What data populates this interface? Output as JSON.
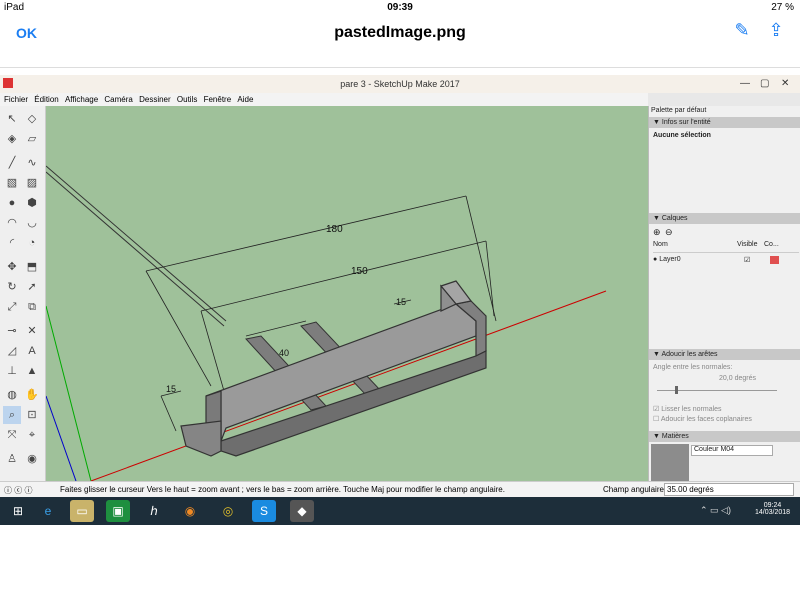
{
  "ios": {
    "carrier": "iPad",
    "time": "09:39",
    "battery": "27 %",
    "ok_label": "OK",
    "title": "pastedImage.png"
  },
  "window": {
    "title": "pare 3 - SketchUp Make 2017"
  },
  "menu": [
    "Fichier",
    "Édition",
    "Affichage",
    "Caméra",
    "Dessiner",
    "Outils",
    "Fenêtre",
    "Aide"
  ],
  "model": {
    "dim_total": "180",
    "dim_inner": "150",
    "dim_small": "15",
    "dim_bar": "40",
    "dim_depth": "15",
    "colors": {
      "model": "#8c8c8c",
      "sky": "#9fc19a",
      "red_axis": "#cc0000",
      "green_axis": "#00aa00",
      "blue_axis": "#0000cc"
    }
  },
  "palette": {
    "title": "Palette par défaut",
    "entity_header": "Infos sur l'entité",
    "entity_value": "Aucune sélection",
    "layers_header": "Calques",
    "col_name": "Nom",
    "col_visible": "Visible",
    "col_color": "Co...",
    "layer0": "Layer0",
    "layer_color": "#e05050",
    "soften_header": "Adoucir les arêtes",
    "angle_label": "Angle entre les normales:",
    "angle_value": "20,0  degrés",
    "smooth_normals": "Lisser les normales",
    "soften_coplanar": "Adoucir les faces coplanaires",
    "materials_header": "Matières",
    "material_name": "Couleur M04"
  },
  "status": {
    "hint": "Faites glisser le curseur  Vers le haut = zoom avant ; vers le bas = zoom arrière. Touche Maj pour modifier le champ angulaire.",
    "field_label": "Champ angulaire",
    "field_value": "35.00 degrés"
  },
  "taskbar": {
    "time": "09:24",
    "date": "14/03/2018"
  }
}
